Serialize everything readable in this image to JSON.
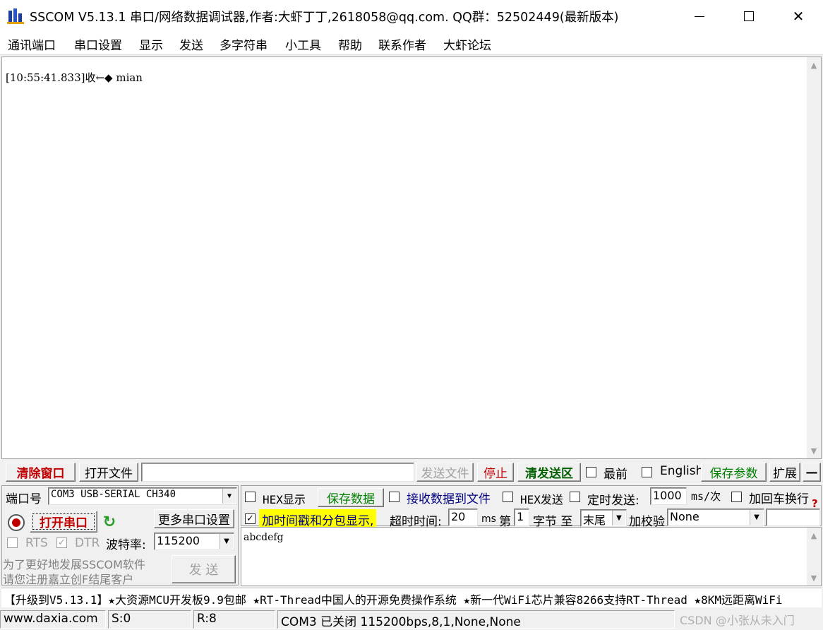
{
  "window": {
    "title": "SSCOM V5.13.1 串口/网络数据调试器,作者:大虾丁丁,2618058@qq.com. QQ群：52502449(最新版本)",
    "controls": {
      "minimize": "—",
      "maximize": "☐",
      "close": "✕"
    }
  },
  "menu": [
    "通讯端口",
    "串口设置",
    "显示",
    "发送",
    "多字符串",
    "小工具",
    "帮助",
    "联系作者",
    "大虾论坛"
  ],
  "receive": {
    "log": "[10:55:41.833]收←◆ mian"
  },
  "toolbar": {
    "clear_window": "清除窗口",
    "open_file": "打开文件",
    "file_path": "",
    "send_file": "发送文件",
    "stop": "停止",
    "clear_send": "清发送区",
    "front_label": "最前",
    "english_label": "English",
    "save_params": "保存参数",
    "expand": "扩展",
    "collapse": "—"
  },
  "port": {
    "label": "端口号",
    "value": "COM3 USB-SERIAL CH340",
    "open_button": "打开串口",
    "more_settings": "更多串口设置",
    "rts_label": "RTS",
    "dtr_label": "DTR",
    "baud_label": "波特率:",
    "baud_value": "115200",
    "promo_line1": "为了更好地发展SSCOM软件",
    "promo_line2": "请您注册嘉立创F结尾客户",
    "send_button": "发 送"
  },
  "options": {
    "hex_display": "HEX显示",
    "save_data": "保存数据",
    "recv_to_file": "接收数据到文件",
    "hex_send": "HEX发送",
    "timed_send": "定时发送:",
    "interval_value": "1000",
    "interval_unit": "ms/次",
    "add_crlf": "加回车换行",
    "timestamp": "加时间戳和分包显示,",
    "timeout_label": "超时时间:",
    "timeout_value": "20",
    "timeout_unit": "ms",
    "byte_prefix": "第",
    "byte_index": "1",
    "byte_suffix": "字节 至",
    "byte_end": "末尾",
    "checksum_label": "加校验",
    "checksum_value": "None",
    "help_glyph": "?"
  },
  "send": {
    "text": "abcdefg"
  },
  "ticker": "【升级到V5.13.1】★大资源MCU开发板9.9包邮 ★RT-Thread中国人的开源免费操作系统 ★新一代WiFi芯片兼容8266支持RT-Thread ★8KM远距离WiFi",
  "status": {
    "website": "www.daxia.com",
    "sent": "S:0",
    "received": "R:8",
    "port_status": "COM3 已关闭  115200bps,8,1,None,None",
    "watermark": "CSDN @小张从未入门"
  },
  "colors": {
    "highlight_yellow": "#ffff00",
    "clear_red": "#c00000",
    "save_green": "#008000",
    "link_blue": "#000080"
  }
}
